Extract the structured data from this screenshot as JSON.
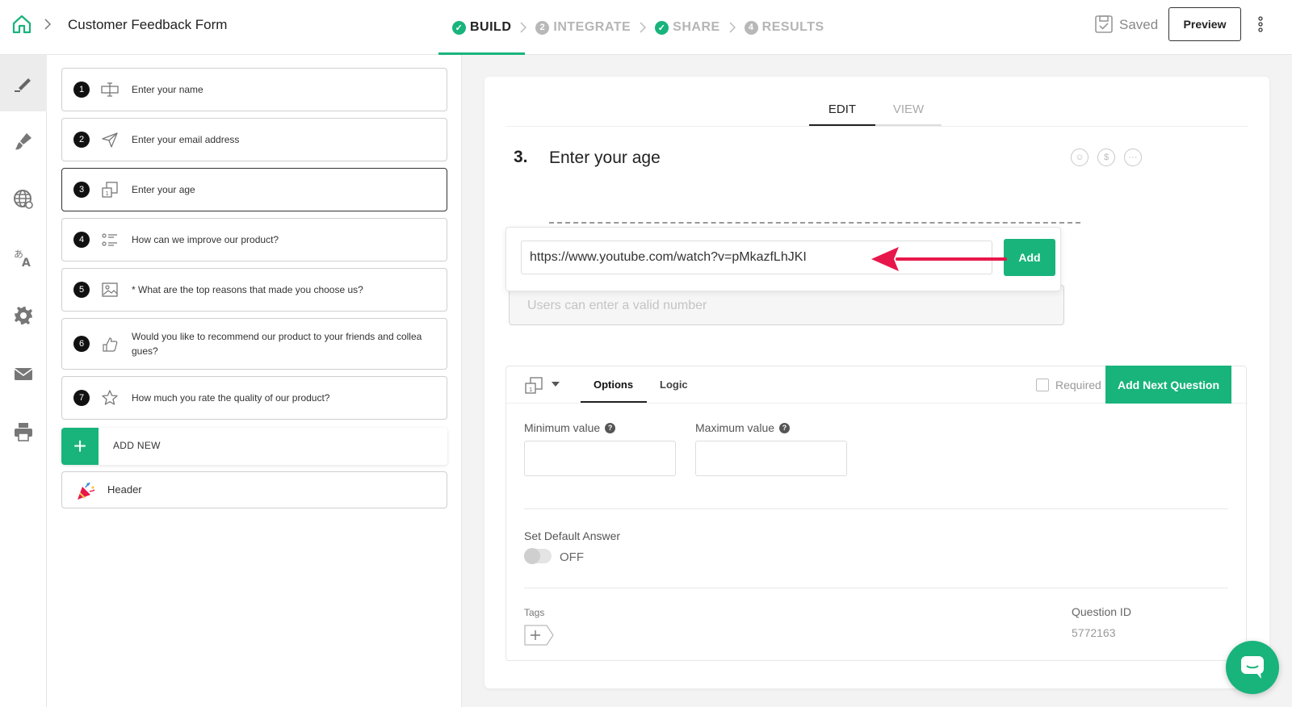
{
  "header": {
    "form_title": "Customer Feedback Form",
    "steps": [
      {
        "label": "BUILD",
        "badge": "✓",
        "state": "done",
        "active": true
      },
      {
        "label": "INTEGRATE",
        "badge": "2",
        "state": "num",
        "active": false
      },
      {
        "label": "SHARE",
        "badge": "✓",
        "state": "done",
        "active": false
      },
      {
        "label": "RESULTS",
        "badge": "4",
        "state": "num",
        "active": false
      }
    ],
    "saved_label": "Saved",
    "preview_label": "Preview"
  },
  "rail": {
    "items": [
      "pencil-icon",
      "paint-brush-icon",
      "globe-icon",
      "translate-icon",
      "gear-icon",
      "mail-icon",
      "printer-icon"
    ]
  },
  "questions": [
    {
      "number": "1",
      "icon": "text-field-icon",
      "text": "Enter your name"
    },
    {
      "number": "2",
      "icon": "send-icon",
      "text": "Enter your email address"
    },
    {
      "number": "3",
      "icon": "number-icon",
      "text": "Enter your age"
    },
    {
      "number": "4",
      "icon": "list-icon",
      "text": "How can we improve our product?"
    },
    {
      "number": "5",
      "icon": "image-icon",
      "text": "* What are the top reasons that made you choose us?"
    },
    {
      "number": "6",
      "icon": "thumbs-up-icon",
      "text": "Would you like to recommend our product to your friends and collea gues?"
    },
    {
      "number": "7",
      "icon": "star-icon",
      "text": "How much you rate the quality of our product?"
    }
  ],
  "add_new_label": "ADD NEW",
  "header_item_label": "Header",
  "editor": {
    "tabs": [
      "EDIT",
      "VIEW"
    ],
    "question_number": "3.",
    "question_title": "Enter your age",
    "url_value": "https://www.youtube.com/watch?v=pMkazfLhJKI",
    "add_label": "Add",
    "number_placeholder": "Users can enter a valid number",
    "options_tab": "Options",
    "logic_tab": "Logic",
    "required_label": "Required",
    "add_next_label": "Add Next Question",
    "min_label": "Minimum value",
    "max_label": "Maximum value",
    "default_answer_label": "Set Default Answer",
    "toggle_state": "OFF",
    "tags_label": "Tags",
    "question_id_label": "Question ID",
    "question_id": "5772163"
  },
  "colors": {
    "accent": "#18b47b",
    "arrow": "#e8174b"
  }
}
